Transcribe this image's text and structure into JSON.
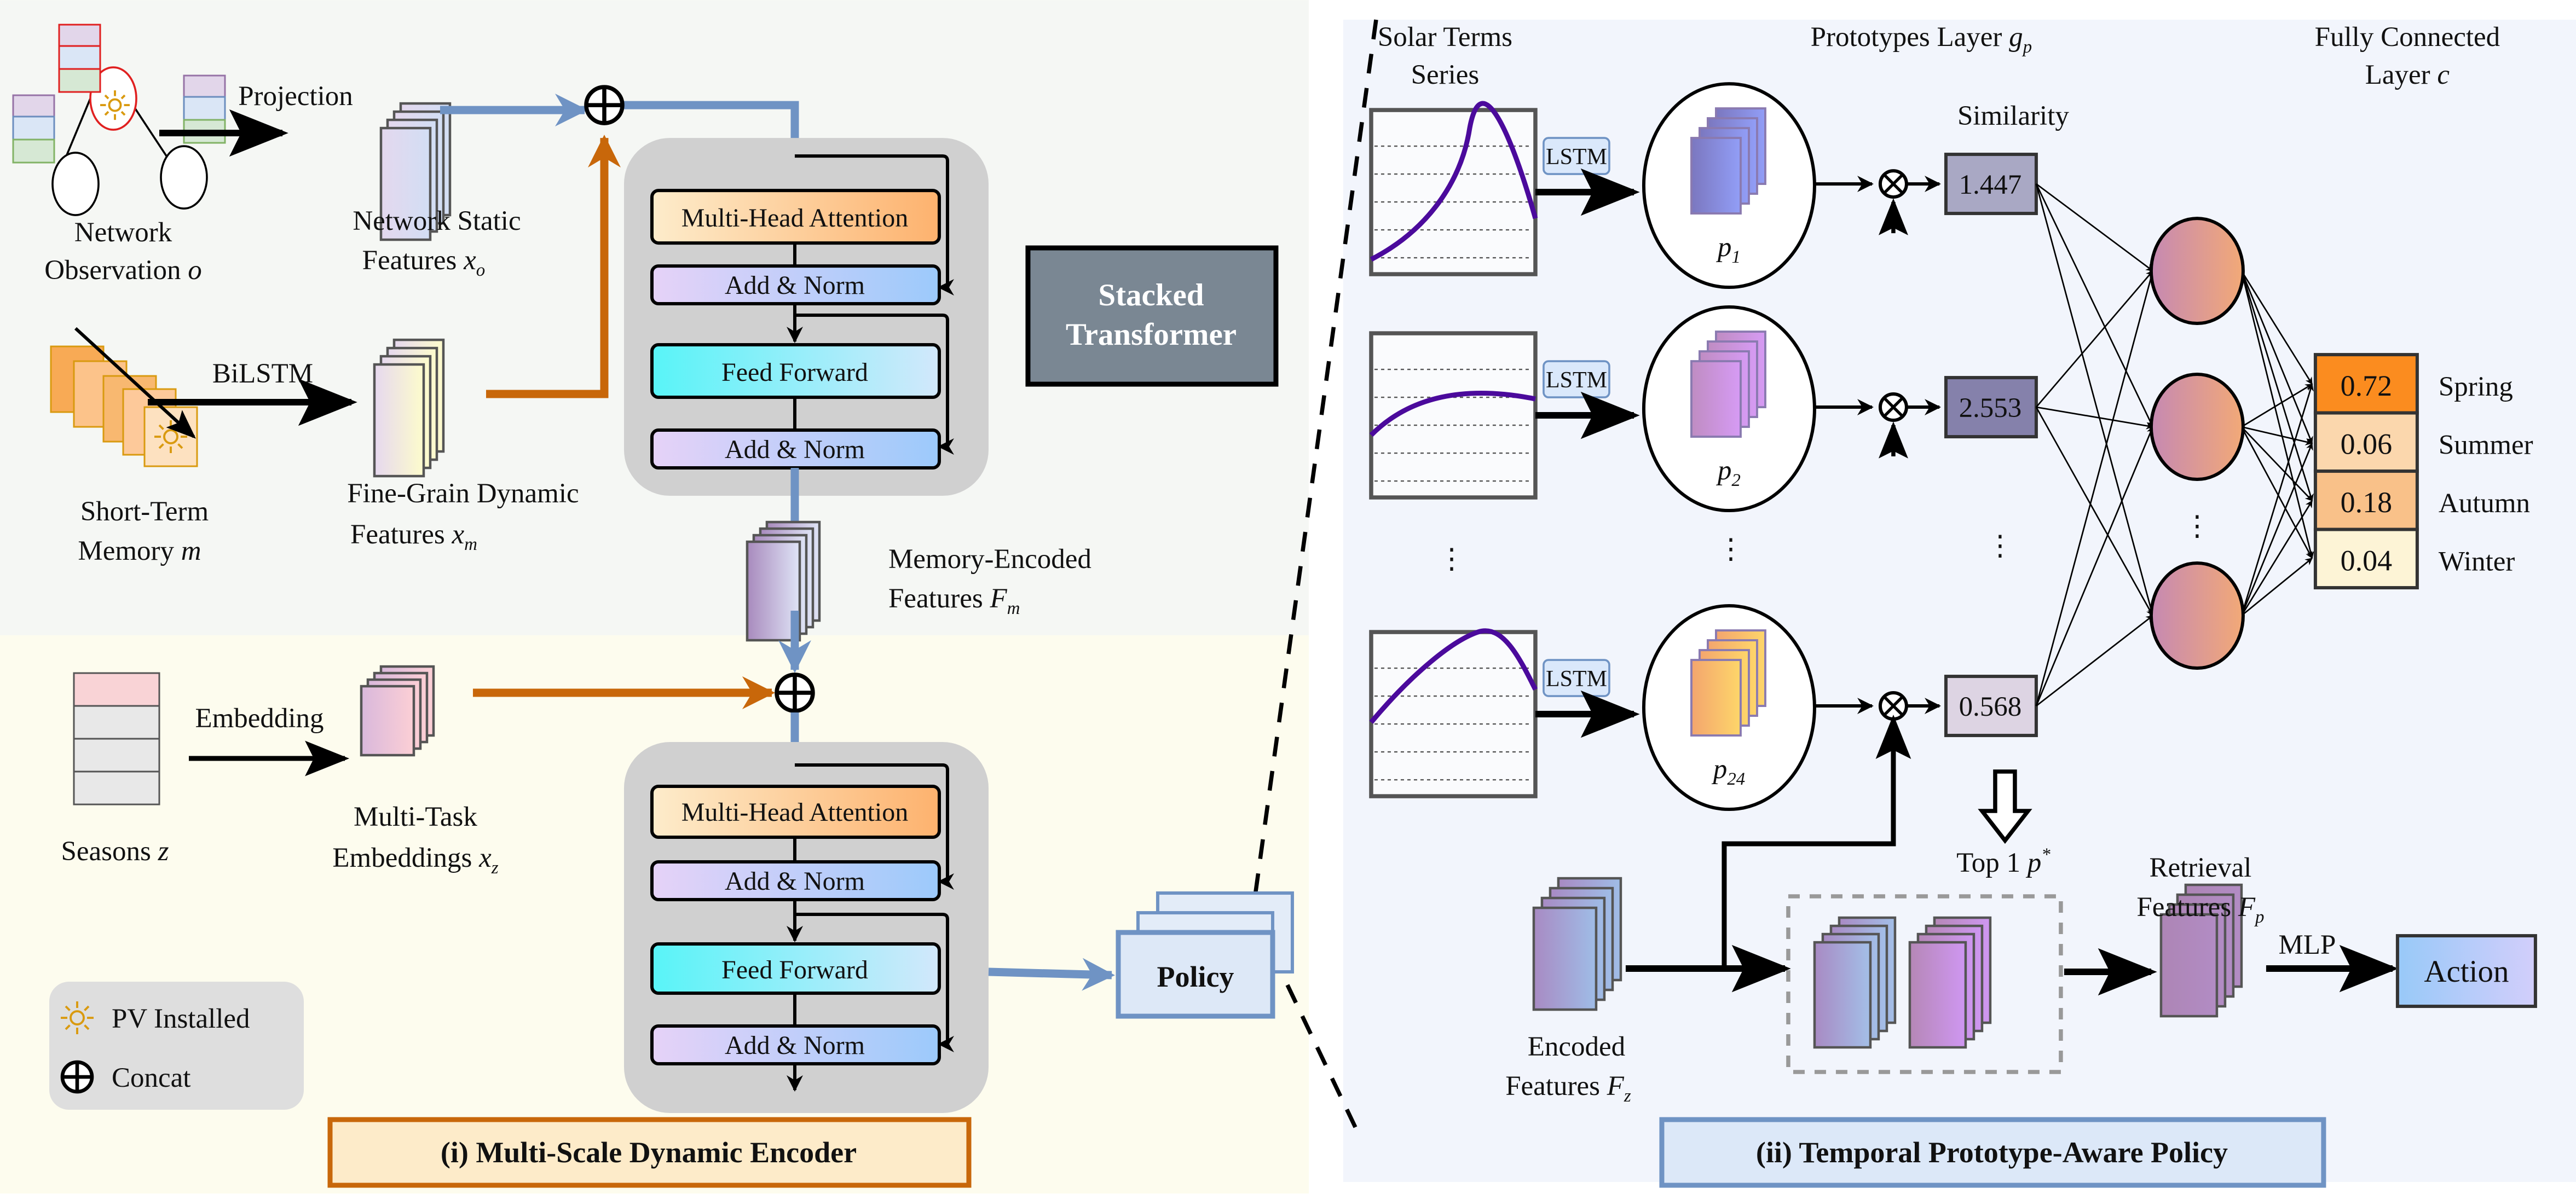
{
  "encoder": {
    "title": "(i) Multi-Scale Dynamic Encoder",
    "network_observation": {
      "line1": "Network",
      "line2": "Observation",
      "symbol": "o"
    },
    "projection": "Projection",
    "static_features": {
      "line1": "Network Static",
      "line2": "Features",
      "symbol": "x",
      "sub": "o"
    },
    "bilstm": "BiLSTM",
    "short_term_memory": {
      "line1": "Short-Term",
      "line2": "Memory",
      "symbol": "m"
    },
    "dynamic_features": {
      "line1": "Fine-Grain Dynamic",
      "line2": "Features",
      "symbol": "x",
      "sub": "m"
    },
    "memory_encoded": {
      "line1": "Memory-Encoded",
      "line2": "Features",
      "symbol": "F",
      "sub": "m"
    },
    "stacked_transformer": {
      "line1": "Stacked",
      "line2": "Transformer"
    },
    "transformer_blocks": {
      "attention": "Multi-Head Attention",
      "add_norm": "Add & Norm",
      "feed_forward": "Feed Forward"
    },
    "seasons": {
      "label": "Seasons",
      "symbol": "z"
    },
    "embedding": "Embedding",
    "task_embeddings": {
      "line1": "Multi-Task",
      "line2": "Embeddings",
      "symbol": "x",
      "sub": "z"
    },
    "policy": "Policy",
    "legend": {
      "pv": "PV Installed",
      "concat": "Concat"
    }
  },
  "policy_module": {
    "title": "(ii) Temporal Prototype-Aware Policy",
    "solar_terms": {
      "line1": "Solar Terms",
      "line2": "Series"
    },
    "prototypes_layer": {
      "label": "Prototypes Layer",
      "symbol": "g",
      "sub": "p"
    },
    "similarity_label": "Similarity",
    "fc_layer": {
      "line1": "Fully Connected",
      "line2": "Layer",
      "symbol": "c"
    },
    "lstm": "LSTM",
    "prototypes": [
      {
        "symbol": "p",
        "sub": "1",
        "similarity": "1.447"
      },
      {
        "symbol": "p",
        "sub": "2",
        "similarity": "2.553"
      },
      {
        "symbol": "p",
        "sub": "24",
        "similarity": "0.568"
      }
    ],
    "ellipsis": "⋮",
    "outputs": [
      {
        "value": "0.72",
        "season": "Spring",
        "color": "#fb8c1f"
      },
      {
        "value": "0.06",
        "season": "Summer",
        "color": "#fbd7ad"
      },
      {
        "value": "0.18",
        "season": "Autumn",
        "color": "#f9c189"
      },
      {
        "value": "0.04",
        "season": "Winter",
        "color": "#fdf4d6"
      }
    ],
    "top1": {
      "label": "Top 1",
      "symbol": "p",
      "sup": "*"
    },
    "encoded_features": {
      "line1": "Encoded",
      "line2": "Features",
      "symbol": "F",
      "sub": "z"
    },
    "retrieval_features": {
      "line1": "Retrieval",
      "line2": "Features",
      "symbol": "F",
      "sub": "p"
    },
    "mlp": "MLP",
    "action": "Action"
  },
  "colors": {
    "encoder_accent": "#c8670a",
    "policy_accent": "#6f93c4",
    "flow_blue": "#6f93c4",
    "flow_orange": "#c8670a"
  }
}
